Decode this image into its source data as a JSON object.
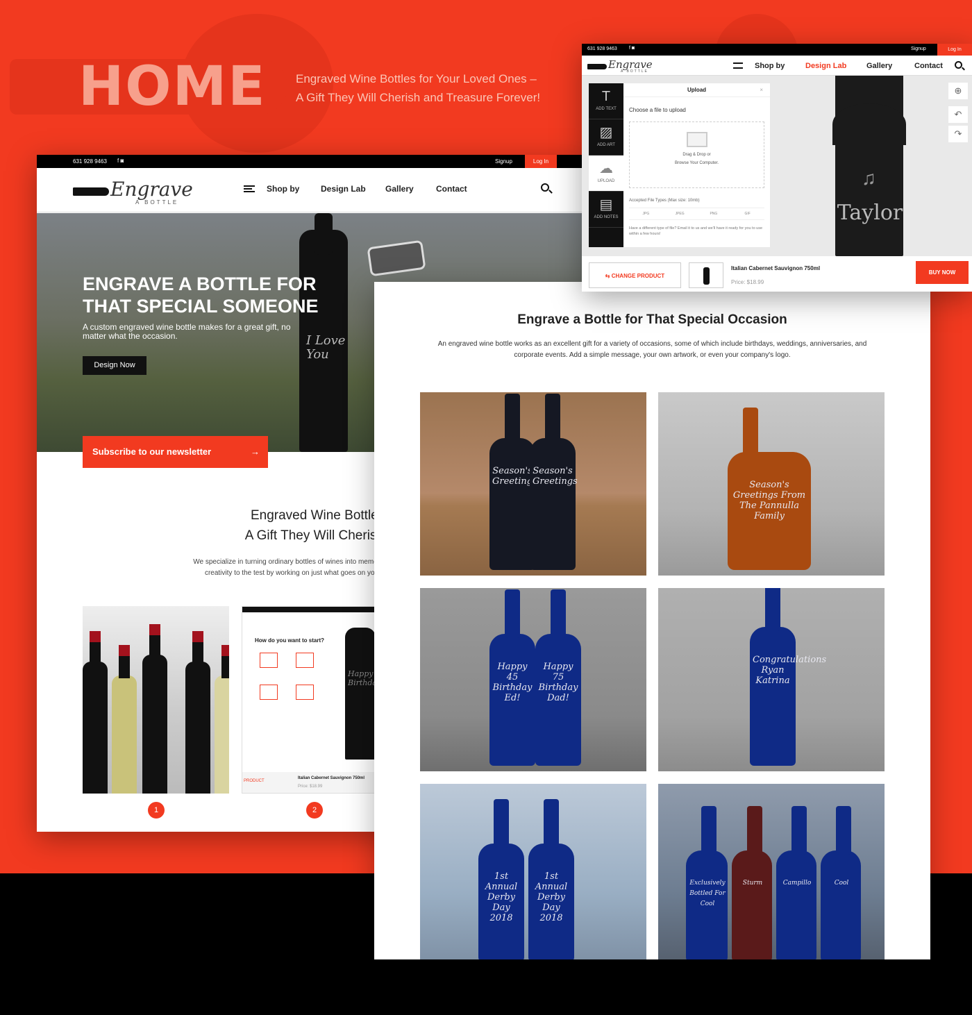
{
  "banner": {
    "title": "HOME",
    "tagline_line1": "Engraved Wine Bottles for Your Loved Ones –",
    "tagline_line2": "A Gift They Will Cherish and Treasure Forever!"
  },
  "site": {
    "phone": "631 928 9463",
    "social": "f  ◙",
    "signup": "Signup",
    "login": "Log In",
    "logo_script": "Engrave",
    "logo_sub": "A BOTTLE",
    "nav": [
      "Shop by",
      "Design Lab",
      "Gallery",
      "Contact"
    ]
  },
  "home_page": {
    "hero_heading": "ENGRAVE A BOTTLE FOR THAT SPECIAL SOMEONE",
    "hero_text": "A custom engraved wine bottle makes for a great gift, no matter what the occasion.",
    "hero_bottle_text": "I Love You",
    "design_now": "Design Now",
    "subscribe": "Subscribe to our newsletter",
    "subscribe_arrow": "→",
    "section_heading_line1": "Engraved Wine Bottles for Your",
    "section_heading_line2": "A Gift They Will Cherish and Trea",
    "section_text_line1": "We specialize in turning ordinary bottles of wines into memorable keepsakes that serv",
    "section_text_line2": "creativity to the test by working on just what goes on your bottle. Then, watch t",
    "mini_question": "How do you want to start?",
    "mini_bottle_text": "Happy Birthday",
    "mini_product": "Italian Cabernet Sauvignon 750ml",
    "mini_price": "Price: $18.99",
    "mini_change": "PRODUCT",
    "steps": [
      "1",
      "2"
    ]
  },
  "gallery_page": {
    "heading": "Engrave a Bottle for That Special Occasion",
    "text": "An engraved wine bottle works as an excellent gift for a variety of occasions, some of which include birthdays, weddings, anniversaries, and corporate events. Add a simple message, your own artwork, or even your company's logo.",
    "tiles": [
      {
        "label_a": "Season's Greetings",
        "label_b": "Season's Greetings"
      },
      {
        "label_a": "Season's Greetings From The Pannulla Family"
      },
      {
        "label_a": "Happy 45 Birthday Ed!",
        "label_b": "Happy 75 Birthday Dad!"
      },
      {
        "label_a": "Congratulations Ryan Katrina"
      },
      {
        "label_a": "1st Annual Derby Day 2018",
        "label_b": "1st Annual Derby Day 2018"
      },
      {
        "label_a": "Exclusively Bottled For Cool",
        "label_b": "Sturm",
        "label_c": "Campillo",
        "label_d": "Cool"
      }
    ]
  },
  "design_lab": {
    "phone": "631 928 9463",
    "social": "f  ◙",
    "signup": "Signup",
    "login": "Log In",
    "nav_shop": "Shop by",
    "nav_design": "Design Lab",
    "nav_gallery": "Gallery",
    "nav_contact": "Contact",
    "tools": [
      "ADD TEXT",
      "ADD ART",
      "UPLOAD",
      "ADD NOTES"
    ],
    "panel_title": "Upload",
    "choose": "Choose a file to upload",
    "drop_line1": "Drag & Drop or",
    "drop_line2": "Browse Your Computer.",
    "accepted": "Accepted File Types (Max size: 10mb)",
    "types": [
      "JPG",
      "JPEG",
      "PNG",
      "GIF"
    ],
    "note": "Have a different type of file? Email it to us and we'll have it ready for you to use within a few hours!",
    "bottle_name": "Taylor",
    "change_product": "CHANGE PRODUCT",
    "product_name": "Italian Cabernet Sauvignon 750ml",
    "price": "Price: $18.99",
    "buy_now": "BUY NOW"
  }
}
